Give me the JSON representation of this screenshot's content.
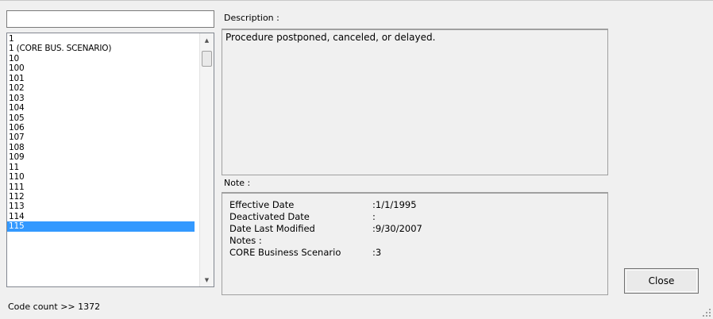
{
  "search": {
    "value": ""
  },
  "code_list": {
    "items": [
      "1",
      "1 (CORE BUS. SCENARIO)",
      "10",
      "100",
      "101",
      "102",
      "103",
      "104",
      "105",
      "106",
      "107",
      "108",
      "109",
      "11",
      "110",
      "111",
      "112",
      "113",
      "114",
      "115"
    ],
    "selected": "115"
  },
  "description": {
    "label": "Description :",
    "text": "Procedure postponed, canceled, or delayed."
  },
  "note": {
    "label": "Note :",
    "rows": [
      {
        "key": "Effective Date",
        "value": ":1/1/1995"
      },
      {
        "key": "Deactivated Date",
        "value": ":"
      },
      {
        "key": "Date Last Modified",
        "value": ":9/30/2007"
      },
      {
        "key": "Notes :",
        "value": ""
      },
      {
        "key": "CORE Business Scenario",
        "value": ":3"
      }
    ]
  },
  "close_label": "Close",
  "code_count_label": "Code count >> 1372",
  "colors": {
    "selection": "#3399ff",
    "window_bg": "#f0f0f0"
  }
}
